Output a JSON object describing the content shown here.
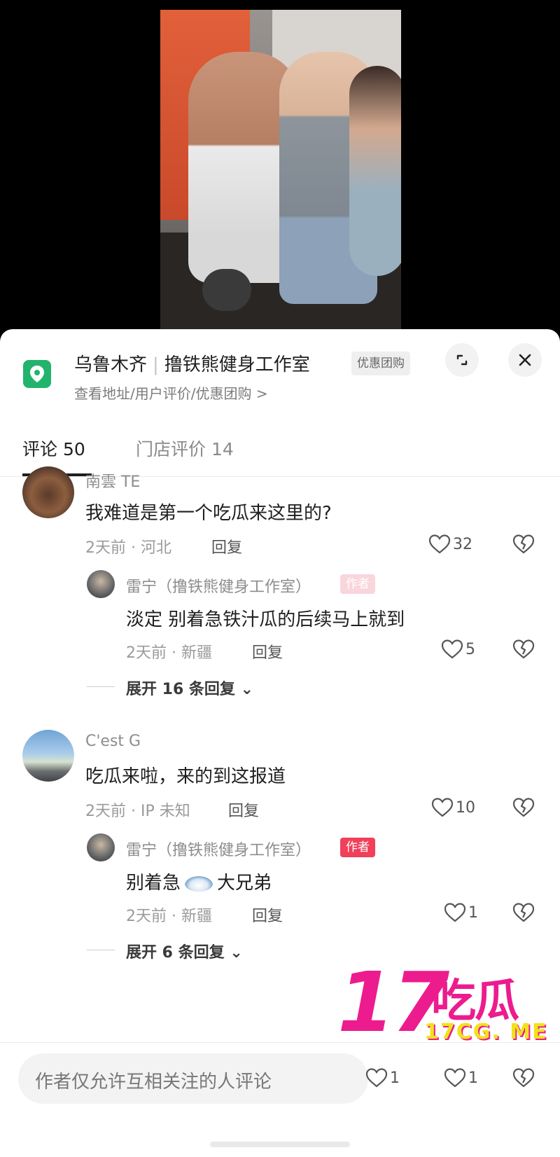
{
  "location": {
    "city": "乌鲁木齐",
    "store": "撸铁熊健身工作室",
    "deal_badge": "优惠团购",
    "subtitle": "查看地址/用户评价/优惠团购 >"
  },
  "tabs": [
    {
      "label": "评论 50"
    },
    {
      "label": "门店评价 14"
    }
  ],
  "comments": [
    {
      "username": "南雲 TE",
      "text": "我难道是第一个吃瓜来这里的?",
      "meta": "2天前 · 河北",
      "reply_label": "回复",
      "likes": "32",
      "reply": {
        "username": "雷宁（撸铁熊健身工作室）",
        "badge": "作者",
        "text": "淡定 别着急铁汁瓜的后续马上就到",
        "meta": "2天前 · 新疆",
        "reply_label": "回复",
        "likes": "5"
      },
      "expand_label": "展开 16 条回复"
    },
    {
      "username": "C'est G",
      "text": "吃瓜来啦，来的到这报道",
      "meta": "2天前 · IP 未知",
      "reply_label": "回复",
      "likes": "10",
      "reply": {
        "username": "雷宁（撸铁熊健身工作室）",
        "badge": "作者",
        "text_before": "别着急",
        "text_after": "大兄弟",
        "meta": "2天前 · 新疆",
        "reply_label": "回复",
        "likes": "1"
      },
      "expand_label": "展开 6 条回复"
    }
  ],
  "input": {
    "placeholder": "作者仅允许互相关注的人评论",
    "likes_a": "1",
    "likes_b": "1"
  },
  "watermark": {
    "big": "17",
    "cn": "吃瓜",
    "domain": "17CG. ME"
  },
  "colors": {
    "accent_red": "#f0405a",
    "location_green": "#23b36c",
    "watermark_pink": "#ec1c8e",
    "watermark_yellow": "#f2e21a"
  }
}
